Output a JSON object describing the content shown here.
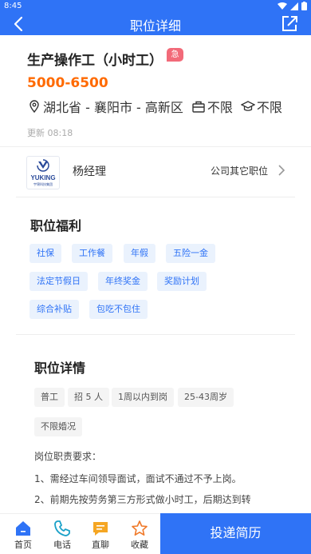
{
  "status_bar": {
    "time": "8:45"
  },
  "app_bar": {
    "title": "职位详细"
  },
  "job": {
    "title": "生产操作工（小时工）",
    "urgent_badge": "急",
    "salary": "5000-6500",
    "location": "湖北省 - 襄阳市 - 高新区",
    "experience": "不限",
    "education": "不限",
    "updated": "更新 08:18"
  },
  "company": {
    "logo_text": "YUKING",
    "logo_subtext": "宇锦科技集团",
    "recruiter": "杨经理",
    "other_jobs_link": "公司其它职位"
  },
  "benefits": {
    "title": "职位福利",
    "tags": [
      "社保",
      "工作餐",
      "年假",
      "五险一金",
      "法定节假日",
      "年终奖金",
      "奖励计划",
      "综合补贴",
      "包吃不包住"
    ]
  },
  "details": {
    "title": "职位详情",
    "tags": [
      "普工",
      "招 5 人",
      "1周以内到岗",
      "25-43周岁",
      "不限婚况"
    ],
    "desc_heading": "岗位职责要求：",
    "desc_lines": [
      "1、需经过车间领导面试，面试不通过不予上岗。",
      "2、前期先按劳务第三方形式做小时工，后期达到转"
    ]
  },
  "bottom_bar": {
    "tabs": [
      {
        "label": "首页",
        "icon": "home-icon"
      },
      {
        "label": "电话",
        "icon": "phone-icon"
      },
      {
        "label": "直聊",
        "icon": "chat-icon"
      },
      {
        "label": "收藏",
        "icon": "star-icon"
      }
    ],
    "apply_label": "投递简历"
  },
  "colors": {
    "primary": "#2f73f6",
    "salary": "#ff6a00",
    "urgent": "#f26a79",
    "chat": "#f5a623",
    "star": "#f07a2a"
  }
}
